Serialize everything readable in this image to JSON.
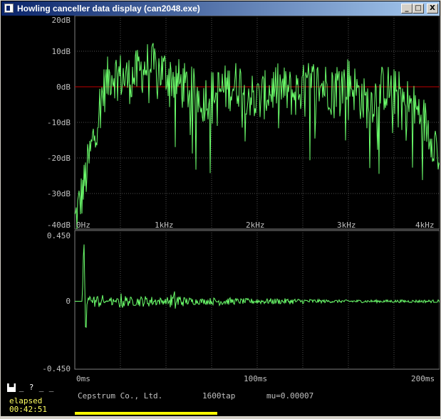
{
  "window": {
    "title": "Howling canceller data display (can2048.exe)",
    "buttons": [
      "_",
      "□",
      "X"
    ]
  },
  "spectrum": {
    "y_ticks": [
      "20dB",
      "10dB",
      "0dB",
      "-10dB",
      "-20dB",
      "-30dB",
      "-40dB"
    ],
    "x_ticks": [
      "0Hz",
      "1kHz",
      "2kHz",
      "3kHz",
      "4kHz"
    ],
    "colors": {
      "trace": "#6cff6c",
      "zero_line": "#c00000",
      "grid": "#505050"
    }
  },
  "cepstrum": {
    "y_ticks": [
      "0.450",
      "0",
      "-0.450"
    ],
    "x_ticks": [
      "0ms",
      "100ms",
      "200ms"
    ]
  },
  "footer": {
    "controls": [
      "▀",
      "_",
      "?",
      "_",
      "_"
    ],
    "elapsed_label": "elapsed",
    "elapsed_time": "00:42:51",
    "company": "Cepstrum Co., Ltd.",
    "taps": "1600tap",
    "mu": "mu=0.00007"
  },
  "chart_data": [
    {
      "type": "line",
      "xlabel": "",
      "ylabel": "",
      "xlim": [
        0,
        4000
      ],
      "ylim": [
        -40,
        20
      ],
      "x_ticks": [
        "0Hz",
        "1kHz",
        "2kHz",
        "3kHz",
        "4kHz"
      ],
      "y_ticks": [
        "20dB",
        "10dB",
        "0dB",
        "-10dB",
        "-20dB",
        "-30dB",
        "-40dB"
      ],
      "grid": true,
      "series": [
        {
          "x": [
            0,
            100,
            200,
            300,
            400,
            500,
            600,
            700,
            800,
            900,
            1000,
            1200,
            1400,
            1600,
            1800,
            2000,
            2200,
            2400,
            2600,
            2800,
            3000,
            3200,
            3400,
            3600,
            3800,
            4000
          ],
          "values": [
            -38,
            -28,
            -15,
            -2,
            4,
            3,
            2,
            4,
            6,
            5,
            4,
            0,
            -3,
            -1,
            1,
            -4,
            0,
            -2,
            1,
            0,
            2,
            -5,
            0,
            -3,
            -8,
            -18
          ]
        }
      ]
    },
    {
      "type": "line",
      "xlabel": "",
      "ylabel": "",
      "xlim": [
        0,
        200
      ],
      "ylim": [
        -0.45,
        0.45
      ],
      "x_ticks": [
        "0ms",
        "100ms",
        "200ms"
      ],
      "y_ticks": [
        "0.450",
        "0",
        "-0.450"
      ],
      "grid": true,
      "series": [
        {
          "x": [
            0,
            4,
            5,
            6,
            7,
            8,
            10,
            15,
            20,
            25,
            30,
            40,
            50,
            55,
            60,
            70,
            80,
            90,
            100,
            120,
            140,
            160,
            180,
            200
          ],
          "values": [
            0,
            0,
            0.45,
            -0.28,
            0.12,
            -0.06,
            0.04,
            0.05,
            -0.04,
            0.06,
            0.03,
            0.04,
            0.02,
            0.08,
            0.03,
            0.02,
            0.03,
            0.02,
            0.02,
            0.02,
            0.01,
            0.01,
            0.01,
            0.01
          ]
        }
      ]
    }
  ]
}
